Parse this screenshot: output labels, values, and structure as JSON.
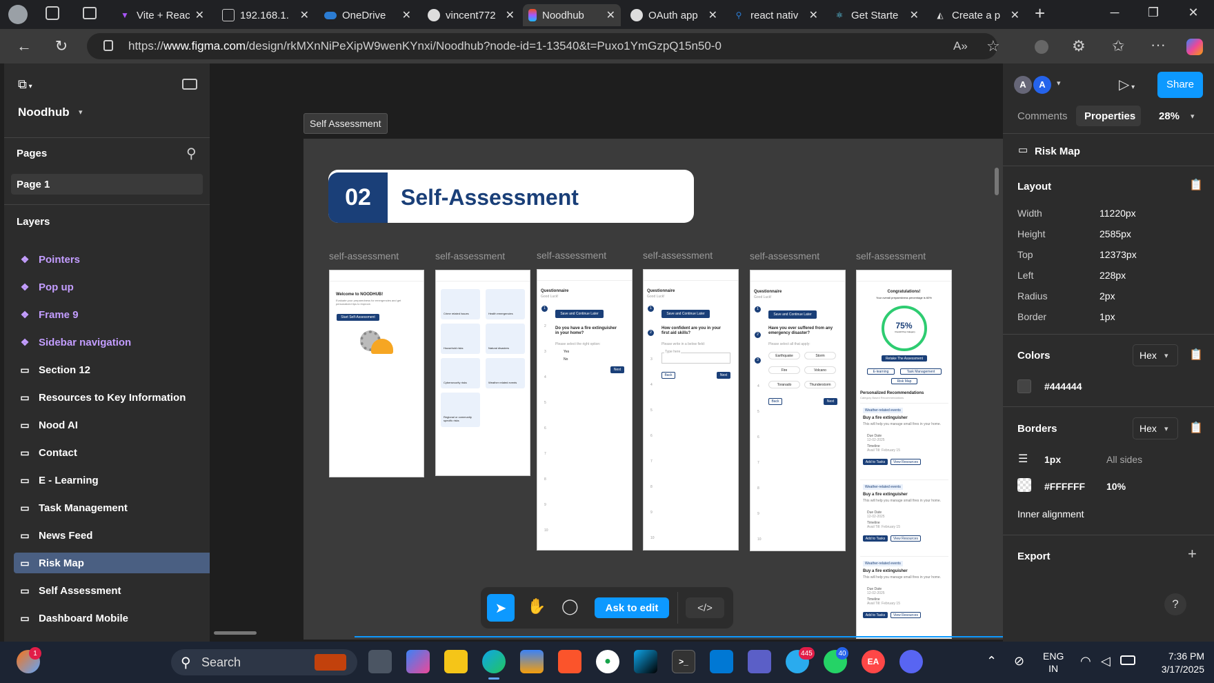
{
  "browser": {
    "tabs": [
      {
        "label": "Vite + React",
        "icon": "vite-icon",
        "color": "#a855f7"
      },
      {
        "label": "192.168.1.",
        "icon": "page-icon",
        "color": "#cccccc"
      },
      {
        "label": "OneDrive",
        "icon": "cloud-icon",
        "color": "#2b7cd3"
      },
      {
        "label": "vincent772",
        "icon": "github-icon",
        "color": "#dddddd"
      },
      {
        "label": "Noodhub",
        "icon": "figma-icon",
        "color": "#f24e1e"
      },
      {
        "label": "OAuth app",
        "icon": "github-icon",
        "color": "#dddddd"
      },
      {
        "label": "react nativ",
        "icon": "search-icon",
        "color": "#2b7cd3"
      },
      {
        "label": "Get Starte",
        "icon": "react-icon",
        "color": "#61dafb"
      },
      {
        "label": "Create a p",
        "icon": "cloudflare-icon",
        "color": "#dddddd"
      }
    ],
    "url_prefix": "https://",
    "url_domain": "www.figma.com",
    "url_rest": "/design/rkMXnNiPeXipW9wenKYnxi/Noodhub?node-id=1-13540&t=Puxo1YmGzpQ15n50-0"
  },
  "left_panel": {
    "file_name": "Noodhub",
    "pages_heading": "Pages",
    "current_page": "Page 1",
    "layers_heading": "Layers",
    "layers": [
      {
        "label": "Pointers",
        "type": "component"
      },
      {
        "label": "Pop up",
        "type": "component"
      },
      {
        "label": "Frame 9",
        "type": "component"
      },
      {
        "label": "Sidebar navigation",
        "type": "component"
      },
      {
        "label": "Section 12",
        "type": "section"
      },
      {
        "label": "Resources to Key Information",
        "type": "section"
      },
      {
        "label": "Nood AI",
        "type": "section"
      },
      {
        "label": "Contact",
        "type": "section"
      },
      {
        "label": "E - Learning",
        "type": "section"
      },
      {
        "label": "Task Management",
        "type": "section"
      },
      {
        "label": "News Feed",
        "type": "section"
      },
      {
        "label": "Risk Map",
        "type": "section",
        "selected": true
      },
      {
        "label": "Self Assessment",
        "type": "section"
      },
      {
        "label": "Dashboard Mobile",
        "type": "section"
      }
    ]
  },
  "canvas": {
    "frame_tag": "Self Assessment",
    "banner_number": "02",
    "banner_title": "Self-Assessment",
    "frame_labels": [
      "self-assessment",
      "self-assessment",
      "self-assessment",
      "self-assessment",
      "self-assessment",
      "self-assessment"
    ],
    "screen1": {
      "welcome": "Welcome to NOODHUB!",
      "desc": "Evaluate your preparedness for emergencies and get personalized tips to improve.",
      "button": "Start Self-Assessment"
    },
    "screen2": {
      "categories": [
        "Crime related Issues",
        "Health emergencies",
        "Household risks",
        "Natural disasters",
        "Cybersecurity risks",
        "Weather related events",
        "Regional or community specific risks"
      ]
    },
    "screen3": {
      "title": "Questionnaire",
      "sub": "Good Luck!",
      "save_btn": "Save and Continue Later",
      "question": "Do you have a fire extinguisher in your home?",
      "hint": "Please select the right option:",
      "options": [
        "Yes",
        "No"
      ],
      "next": "Next"
    },
    "screen4": {
      "title": "Questionnaire",
      "sub": "Good Luck!",
      "save_btn": "Save and Continue Later",
      "question": "How confident are you in your first aid skills?",
      "hint": "Please write in a below field:",
      "placeholder": "Type here",
      "back": "Back",
      "next": "Next"
    },
    "screen5": {
      "title": "Questionnaire",
      "sub": "Good Luck!",
      "save_btn": "Save and Continue Later",
      "question": "Have you ever suffered from any emergency disaster?",
      "hint": "Please select all that apply:",
      "chips": [
        "Earthquake",
        "Storm",
        "Fire",
        "Volcano",
        "Toranado",
        "Thunderstorm"
      ],
      "back": "Back",
      "next": "Next"
    },
    "screen6": {
      "title": "Congratulations!",
      "sub": "Your overall preparedness percentage is 60%",
      "percent": "75%",
      "percent_label": "Overall Prep Category",
      "retake": "Retake The Assessment",
      "links": [
        "E-learning",
        "Task Management",
        "Risk Map"
      ],
      "rec_title": "Personalized Recommendations",
      "rec_sub": "Category Based Recommendations",
      "tag": "Weather-related events",
      "item": "Buy a fire extinguisher",
      "item_desc": "This will help you manage small fires in your home.",
      "due_label": "Due Date",
      "due": "12-02-2025",
      "timeline_label": "Timeline",
      "timeline": "Avail Till: February 15",
      "add": "Add to Tasks",
      "view": "View Resources"
    },
    "steps": [
      "1",
      "2",
      "3",
      "4",
      "5",
      "6",
      "7",
      "8",
      "9",
      "10"
    ]
  },
  "toolbar": {
    "ask_edit": "Ask to edit",
    "dev": "</>"
  },
  "right_panel": {
    "avatars": [
      "A",
      "A"
    ],
    "share": "Share",
    "tabs": [
      "Comments",
      "Properties"
    ],
    "zoom": "28%",
    "selection": "Risk Map",
    "layout_heading": "Layout",
    "props": [
      {
        "label": "Width",
        "value": "11220px"
      },
      {
        "label": "Height",
        "value": "2585px"
      },
      {
        "label": "Top",
        "value": "12373px"
      },
      {
        "label": "Left",
        "value": "228px"
      },
      {
        "label": "Radius",
        "value": "2px"
      },
      {
        "label": "Border",
        "value": "1px"
      }
    ],
    "colors_heading": "Colors",
    "color_mode": "Hex",
    "fill_hex": "#444444",
    "borders_heading": "Borders",
    "border_mode": "Hex",
    "border_width": "1px",
    "border_sides": "All sides",
    "border_hex": "#FFFFFF",
    "border_opacity": "10%",
    "inner_alignment": "Inner alignment",
    "export_heading": "Export"
  },
  "taskbar": {
    "search": "Search",
    "lang": "ENG",
    "region": "IN",
    "time": "7:36 PM",
    "date": "3/17/2025",
    "badges": {
      "widgets": "1",
      "telegram": "445",
      "whatsapp": "40"
    }
  }
}
